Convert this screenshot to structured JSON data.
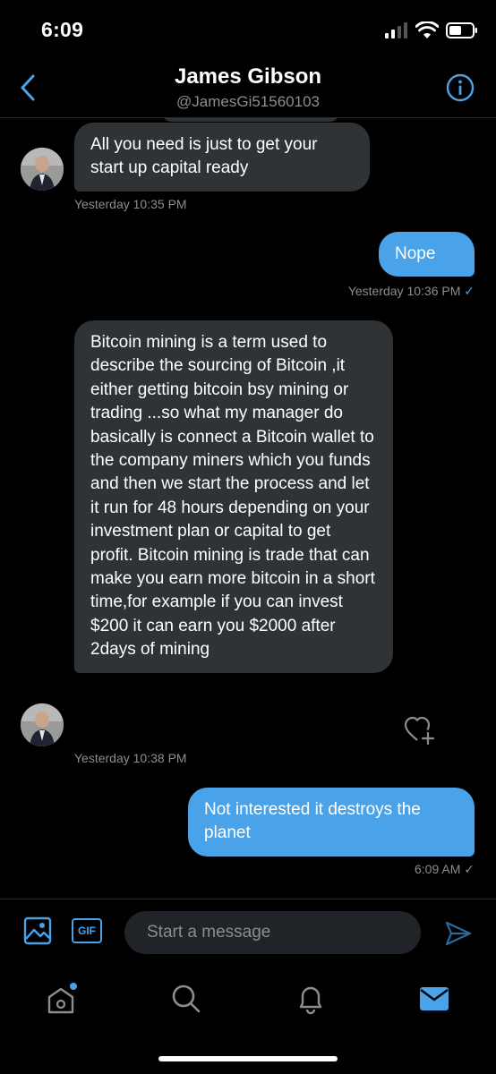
{
  "status_bar": {
    "time": "6:09"
  },
  "header": {
    "title": "James Gibson",
    "handle": "@JamesGi51560103"
  },
  "messages": [
    {
      "direction": "in",
      "text": "All you need is just to get your start up capital ready",
      "timestamp": "Yesterday 10:35 PM"
    },
    {
      "direction": "out",
      "text": "Nope",
      "timestamp": "Yesterday 10:36 PM"
    },
    {
      "direction": "in",
      "text": "Bitcoin mining is a term used to describe the sourcing of Bitcoin ,it either getting bitcoin bsy mining or trading ...so what my manager do basically is connect a Bitcoin wallet to the company miners which you funds and then we start the process and let it run for 48 hours  depending on your investment plan or capital to get profit.  Bitcoin mining is trade that can make you earn more bitcoin in a short time,for example if you can invest $200 it can earn you $2000 after 2days of mining",
      "timestamp": "Yesterday 10:38 PM"
    },
    {
      "direction": "out",
      "text": "Not interested it destroys the planet",
      "timestamp": "6:09 AM"
    }
  ],
  "composer": {
    "placeholder": "Start a message",
    "gif_label": "GIF"
  },
  "colors": {
    "accent": "#4aa3e8",
    "incoming_bubble": "#2f3336",
    "background": "#000000",
    "muted_text": "#8a8d91"
  },
  "icons": {
    "back": "chevron-left-icon",
    "info": "info-icon",
    "image": "image-icon",
    "gif": "gif-icon",
    "send": "send-icon",
    "heart_plus": "heart-plus-icon",
    "home": "home-icon",
    "search": "search-icon",
    "notifications": "bell-icon",
    "messages": "mail-icon"
  }
}
